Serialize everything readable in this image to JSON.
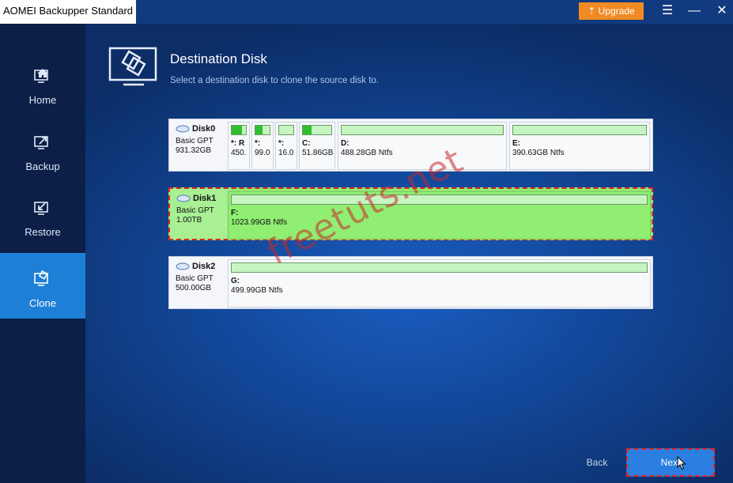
{
  "window": {
    "title": "AOMEI Backupper Standard",
    "upgrade_label": "Upgrade",
    "menu_icon": "menu-icon",
    "minimize_icon": "minimize-icon",
    "close_icon": "close-icon"
  },
  "sidebar": {
    "items": [
      {
        "label": "Home",
        "icon": "home-icon"
      },
      {
        "label": "Backup",
        "icon": "backup-icon"
      },
      {
        "label": "Restore",
        "icon": "restore-icon"
      },
      {
        "label": "Clone",
        "icon": "clone-icon",
        "active": true
      }
    ]
  },
  "header": {
    "title": "Destination Disk",
    "subtitle": "Select a destination disk to clone the source disk to."
  },
  "disks": [
    {
      "name": "Disk0",
      "type": "Basic GPT",
      "size": "931.32GB",
      "partitions": [
        {
          "label": "*: R",
          "detail": "450.",
          "used": 0.7
        },
        {
          "label": "*:",
          "detail": "99.0",
          "used": 0.5
        },
        {
          "label": "*:",
          "detail": "16.0",
          "used": 0
        },
        {
          "label": "C:",
          "detail": "51.86GB",
          "used": 0.3
        },
        {
          "label": "D:",
          "detail": "488.28GB Ntfs",
          "used": 0
        },
        {
          "label": "E:",
          "detail": "390.63GB Ntfs",
          "used": 0
        }
      ]
    },
    {
      "name": "Disk1",
      "type": "Basic GPT",
      "size": "1.00TB",
      "selected": true,
      "partitions": [
        {
          "label": "F:",
          "detail": "1023.99GB Ntfs",
          "used": 0
        }
      ]
    },
    {
      "name": "Disk2",
      "type": "Basic GPT",
      "size": "500.00GB",
      "partitions": [
        {
          "label": "G:",
          "detail": "499.99GB Ntfs",
          "used": 0
        }
      ]
    }
  ],
  "watermark": "freetuts.net",
  "footer": {
    "back_label": "Back",
    "next_label": "Next"
  },
  "colors": {
    "accent": "#2a7fe0",
    "upgrade": "#f08a24",
    "selected_disk": "#90ee72",
    "highlight_border": "#e0252b"
  }
}
